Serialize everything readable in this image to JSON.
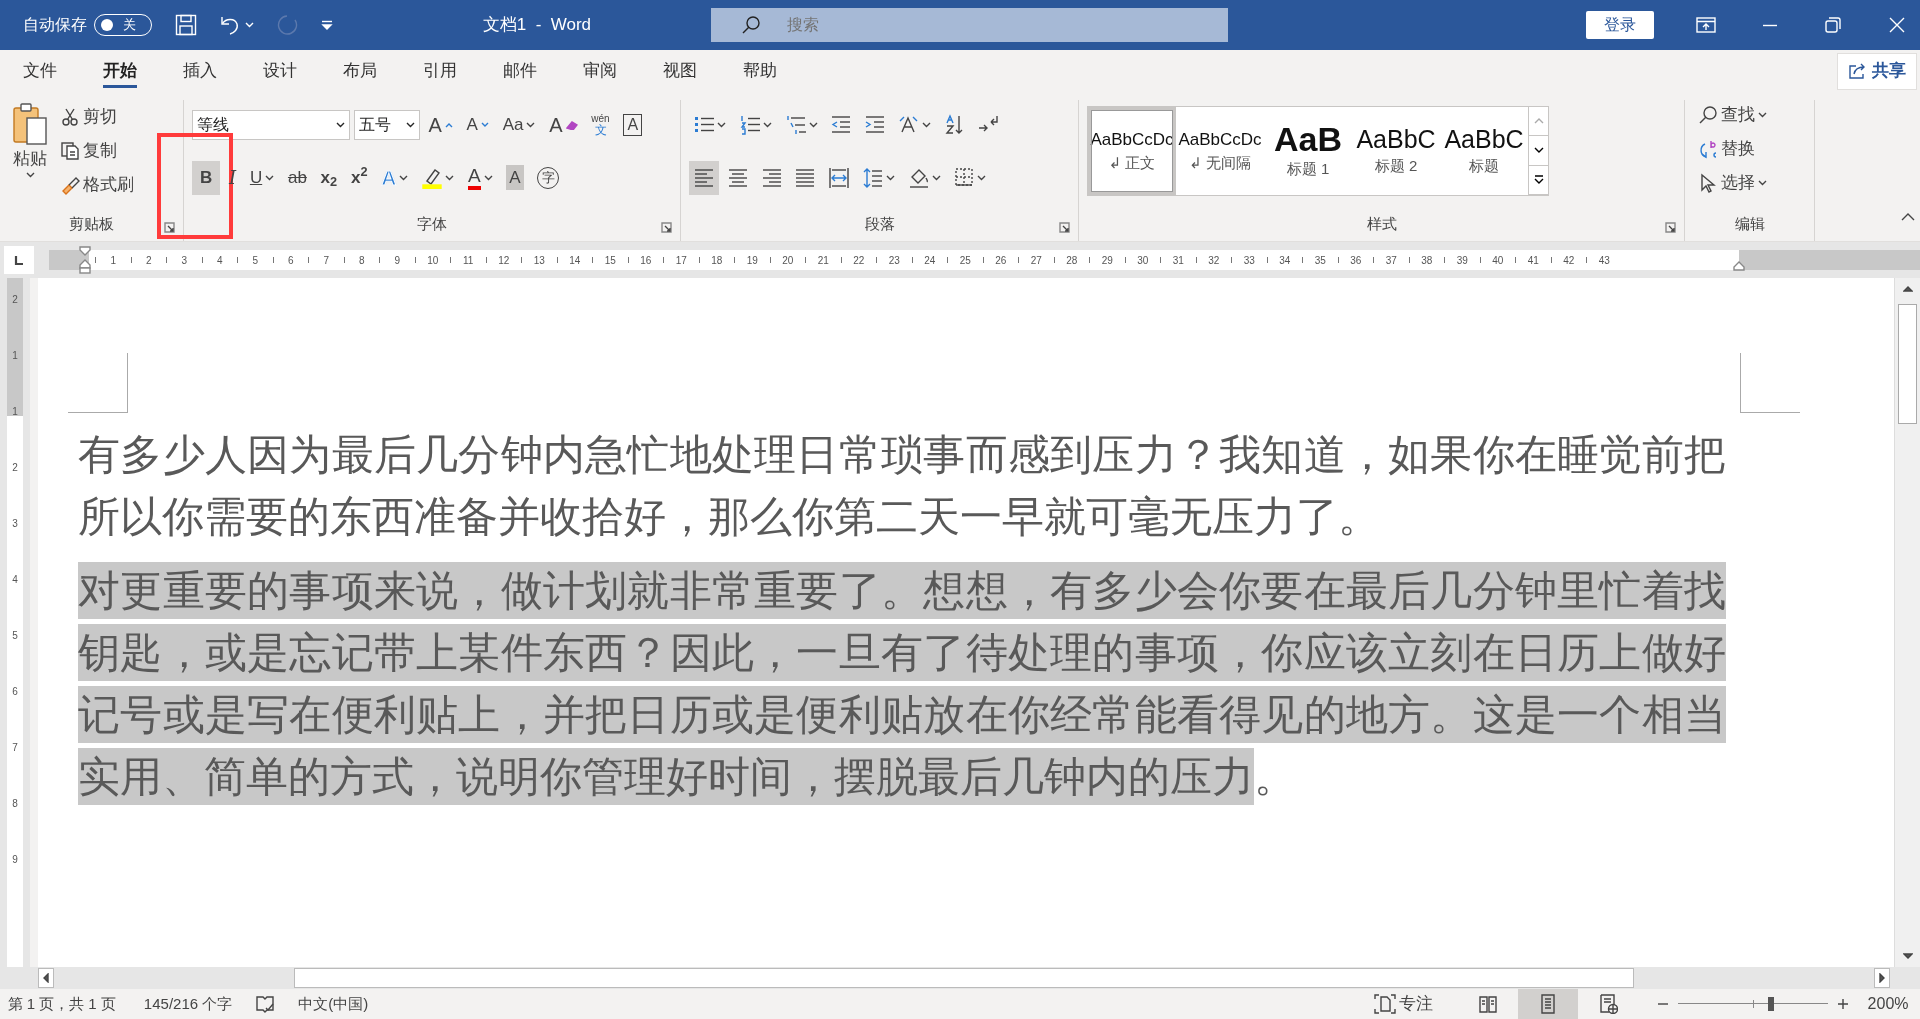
{
  "title_bar": {
    "autosave_label": "自动保存",
    "autosave_on": false,
    "autosave_state": "关",
    "title": "文档1  -  Word",
    "search_placeholder": "搜索",
    "signin": "登录"
  },
  "ribbon_tabs": [
    {
      "label": "文件",
      "selected": false
    },
    {
      "label": "开始",
      "selected": true
    },
    {
      "label": "插入",
      "selected": false
    },
    {
      "label": "设计",
      "selected": false
    },
    {
      "label": "布局",
      "selected": false
    },
    {
      "label": "引用",
      "selected": false
    },
    {
      "label": "邮件",
      "selected": false
    },
    {
      "label": "审阅",
      "selected": false
    },
    {
      "label": "视图",
      "selected": false
    },
    {
      "label": "帮助",
      "selected": false
    }
  ],
  "share": "共享",
  "clipboard": {
    "group": "剪贴板",
    "paste": "粘贴",
    "items": [
      {
        "kind": "cut",
        "label": "剪切"
      },
      {
        "kind": "copy",
        "label": "复制"
      },
      {
        "kind": "painter",
        "label": "格式刷"
      }
    ]
  },
  "font": {
    "group": "字体",
    "name": "等线",
    "size": "五号",
    "row1": [
      {
        "kind": "grow",
        "label": "A"
      },
      {
        "kind": "shrink",
        "label": "A"
      },
      {
        "kind": "case",
        "label": "Aa"
      },
      {
        "kind": "clear",
        "label": "A"
      },
      {
        "kind": "phonetic",
        "label": "wén",
        "sub": "文"
      },
      {
        "kind": "border",
        "label": "A"
      }
    ],
    "row2": [
      {
        "kind": "bold",
        "label": "B",
        "on": true,
        "highlighted": true
      },
      {
        "kind": "italic",
        "label": "I",
        "on": false,
        "highlighted": false
      },
      {
        "kind": "underline",
        "label": "U",
        "on": false,
        "highlighted": false
      },
      {
        "kind": "strike",
        "label": "ab",
        "on": false,
        "highlighted": false
      },
      {
        "kind": "sub",
        "label": "x$_{2}$",
        "on": false,
        "highlighted": false
      },
      {
        "kind": "sup",
        "label": "x$^{2}$",
        "on": false,
        "highlighted": false
      },
      {
        "kind": "effects",
        "label": "A",
        "on": false,
        "highlighted": false
      },
      {
        "kind": "highlight",
        "on": false,
        "highlighted": false
      },
      {
        "kind": "color",
        "label": "A",
        "on": false,
        "highlighted": false
      },
      {
        "kind": "shade",
        "label": "A",
        "on": false,
        "highlighted": false
      },
      {
        "kind": "enclose",
        "label": "字",
        "on": false,
        "highlighted": false
      }
    ]
  },
  "paragraph": {
    "group": "段落",
    "row1": [
      {
        "kind": "bullets"
      },
      {
        "kind": "numbering"
      },
      {
        "kind": "multilevel"
      },
      {
        "kind": "outdent"
      },
      {
        "kind": "indent"
      },
      {
        "kind": "asian"
      },
      {
        "kind": "sort"
      },
      {
        "kind": "marks"
      }
    ],
    "row2": [
      {
        "kind": "left",
        "selected": true
      },
      {
        "kind": "center",
        "selected": false
      },
      {
        "kind": "right",
        "selected": false
      },
      {
        "kind": "justify",
        "selected": false
      },
      {
        "kind": "distribute",
        "selected": false
      },
      {
        "kind": "spacing",
        "selected": false
      },
      {
        "kind": "shading",
        "selected": false
      },
      {
        "kind": "borders",
        "selected": false
      }
    ]
  },
  "styles": {
    "group": "样式",
    "items": [
      {
        "kind": "normal",
        "preview": "AaBbCcDc",
        "mark": "↲",
        "name": "正文",
        "selected": true
      },
      {
        "kind": "normal",
        "preview": "AaBbCcDc",
        "mark": "↲",
        "name": "无间隔",
        "selected": false
      },
      {
        "kind": "heading1",
        "preview": "AaB",
        "name": "标题 1",
        "selected": false
      },
      {
        "kind": "heading2",
        "preview": "AaBbC",
        "name": "标题 2",
        "selected": false
      },
      {
        "kind": "title",
        "preview": "AaBbC",
        "name": "标题",
        "selected": false
      }
    ]
  },
  "editing": {
    "group": "编辑",
    "items": [
      {
        "kind": "find",
        "label": "查找",
        "dropdown": true
      },
      {
        "kind": "replace",
        "label": "替换",
        "dropdown": false
      },
      {
        "kind": "select",
        "label": "选择",
        "dropdown": true
      }
    ]
  },
  "ruler": {
    "numbers": [
      "1",
      "2",
      "3",
      "4",
      "5",
      "6",
      "7",
      "8",
      "9",
      "10",
      "11",
      "12",
      "13",
      "14",
      "15",
      "16",
      "17",
      "18",
      "19",
      "20",
      "21",
      "22",
      "23",
      "24",
      "25",
      "26",
      "27",
      "28",
      "29",
      "30",
      "31",
      "32",
      "33",
      "34",
      "35",
      "36",
      "37",
      "38",
      "39",
      "40",
      "41",
      "42",
      "43"
    ]
  },
  "vertical_ruler": {
    "numbers": [
      "2",
      "1",
      "1",
      "2",
      "3",
      "4",
      "5",
      "6",
      "7",
      "8",
      "9"
    ]
  },
  "document": {
    "paragraphs": [
      {
        "text": "有多少人因为最后几分钟内急忙地处理日常琐事而感到压力？我知道，如果你在睡觉前把所以你需要的东西准备并收拾好，那么你第二天一早就可毫无压力了。",
        "selected": false
      },
      {
        "text": "对更重要的事项来说，做计划就非常重要了。想想，有多少会你要在最后几分钟里忙着找钥匙，或是忘记带上某件东西？因此，一旦有了待处理的事项，你应该立刻在日历上做好记号或是写在便利贴上，并把日历或是便利贴放在你经常能看得见的地方。这是一个相当实用、简单的方式，说明你管理好时间，摆脱最后几钟内的压力",
        "tail": "。",
        "selected": true
      }
    ]
  },
  "status_bar": {
    "page": "第 1 页，共 1 页",
    "words": "145/216 个字",
    "language": "中文(中国)",
    "focus": "专注",
    "views": [
      {
        "kind": "read",
        "selected": false
      },
      {
        "kind": "print",
        "selected": true
      },
      {
        "kind": "web",
        "selected": false
      }
    ],
    "zoom": {
      "level": 0.62,
      "reading": "200%"
    }
  }
}
